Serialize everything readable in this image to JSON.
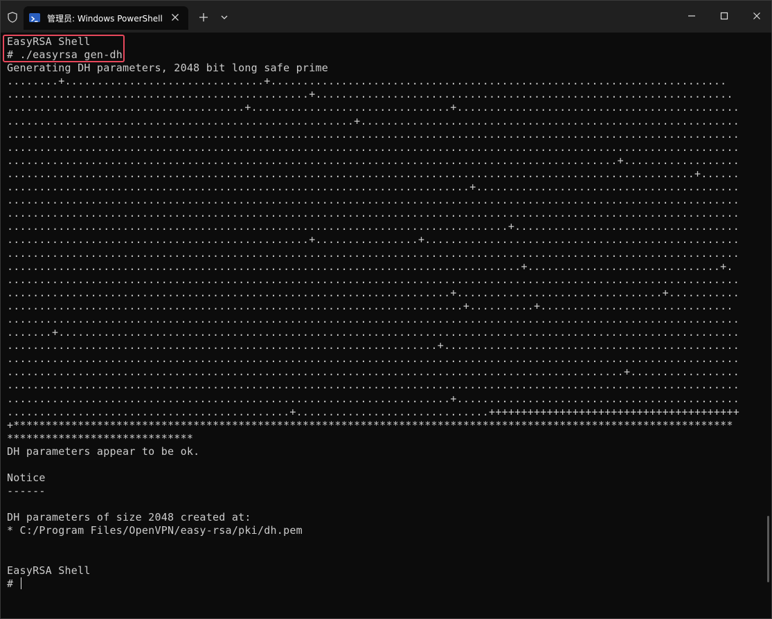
{
  "window": {
    "tab_title": "管理员: Windows PowerShell",
    "icons": {
      "shield": "shield-icon",
      "tab": "powershell-icon",
      "tab_close": "close-icon",
      "new_tab": "plus-icon",
      "dropdown": "chevron-down-icon",
      "minimize": "minimize-icon",
      "maximize": "maximize-icon",
      "close": "close-icon"
    }
  },
  "terminal": {
    "lines": [
      "EasyRSA Shell",
      "# ./easyrsa gen-dh",
      "Generating DH parameters, 2048 bit long safe prime",
      "........+...............................+.......................................................................",
      "...............................................+.................................................................",
      ".....................................+...............................+............................................",
      "......................................................+...........................................................",
      "..................................................................................................................",
      "..................................................................................................................",
      "...............................................................................................+..................",
      "...........................................................................................................+......",
      "........................................................................+.........................................",
      "..................................................................................................................",
      "..................................................................................................................",
      "..............................................................................+...................................",
      "...............................................+................+.................................................",
      "..................................................................................................................",
      "................................................................................+..............................+.",
      "..................................................................................................................",
      ".....................................................................+................................+...........",
      ".......................................................................+..........+..............................",
      "..................................................................................................................",
      ".......+..........................................................................................................",
      "...................................................................+..............................................",
      "..................................................................................................................",
      "................................................................................................+.................",
      "..................................................................................................................",
      ".....................................................................+............................................",
      "............................................+..............................+++++++++++++++++++++++++++++++++++++++",
      "+****************************************************************************************************************",
      "*****************************",
      "DH parameters appear to be ok.",
      "",
      "Notice",
      "------",
      "",
      "DH parameters of size 2048 created at:",
      "* C:/Program Files/OpenVPN/easy-rsa/pki/dh.pem",
      "",
      "",
      "EasyRSA Shell",
      "# "
    ],
    "highlight_color": "#e8485c",
    "background": "#0c0c0c",
    "foreground": "#cccccc"
  }
}
